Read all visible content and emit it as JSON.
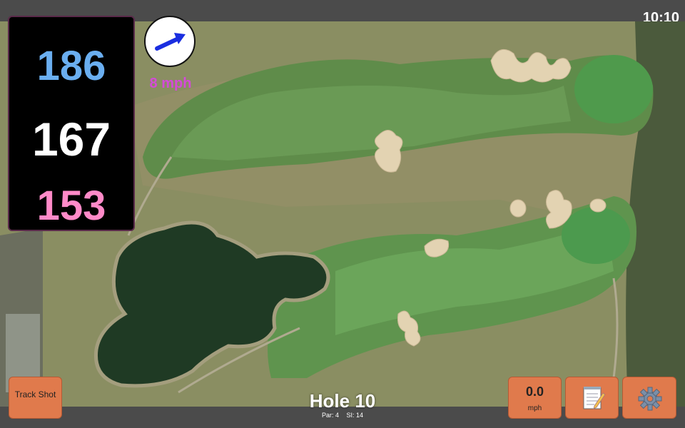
{
  "status": {
    "time": "10:10"
  },
  "distances": {
    "back": "186",
    "center": "167",
    "front": "153"
  },
  "wind": {
    "speed": "8 mph",
    "icon": "wind-arrow-icon"
  },
  "hole": {
    "title": "Hole 10",
    "par": "Par: 4",
    "si": "SI: 14"
  },
  "buttons": {
    "track_shot": "Track Shot",
    "speed_value": "0.0",
    "speed_unit": "mph",
    "notes_icon": "notepad-icon",
    "settings_icon": "gear-icon"
  },
  "colors": {
    "back_distance": "#6aaef0",
    "center_distance": "#ffffff",
    "front_distance": "#ff8ac8",
    "wind_text": "#d44ad8",
    "button_bg": "#e07a4c"
  }
}
